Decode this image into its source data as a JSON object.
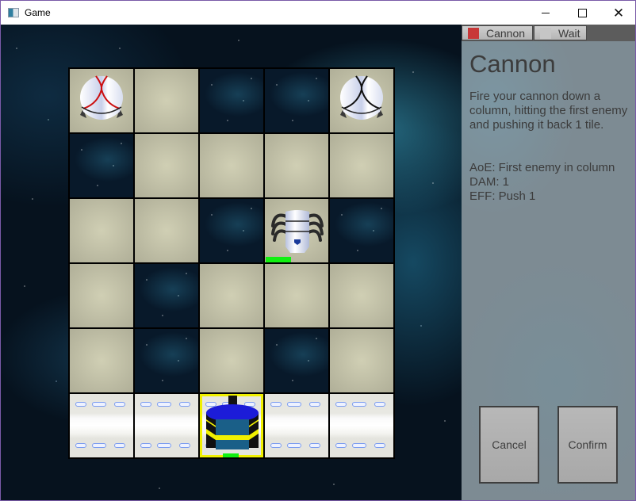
{
  "window": {
    "title": "Game",
    "controls": [
      "minimize",
      "maximize",
      "close"
    ]
  },
  "board": {
    "columns": 5,
    "rows": 6,
    "cells": [
      [
        "tan",
        "tan",
        "space",
        "space",
        "tan"
      ],
      [
        "space",
        "tan",
        "tan",
        "tan",
        "tan"
      ],
      [
        "tan",
        "tan",
        "space",
        "tan",
        "space"
      ],
      [
        "tan",
        "space",
        "tan",
        "tan",
        "tan"
      ],
      [
        "tan",
        "space",
        "tan",
        "space",
        "tan"
      ],
      [
        "base",
        "base",
        "base",
        "base",
        "base"
      ]
    ],
    "units": [
      {
        "type": "dome-enemy",
        "row": 0,
        "col": 0,
        "accent": "#cc1010"
      },
      {
        "type": "dome-enemy",
        "row": 0,
        "col": 4,
        "accent": "#111111"
      },
      {
        "type": "spider-enemy",
        "row": 2,
        "col": 3,
        "health_fraction": 1.0
      },
      {
        "type": "player-cannon",
        "row": 5,
        "col": 2,
        "selected": true,
        "health_fraction": 1.0
      }
    ],
    "colors": {
      "selection": "#f0f000",
      "health": "#10f010"
    }
  },
  "panel": {
    "tabs": [
      {
        "label": "Cannon",
        "swatch": "#c83838",
        "active": true
      },
      {
        "label": "Wait",
        "swatch": "#c6c6c6",
        "active": false
      }
    ],
    "ability": {
      "title": "Cannon",
      "description": "Fire your cannon down a column, hitting the first enemy and pushing it back 1 tile.",
      "aoe": "AoE: First enemy in column",
      "damage": "DAM: 1",
      "effect": "EFF: Push 1"
    },
    "buttons": {
      "cancel": "Cancel",
      "confirm": "Confirm"
    }
  }
}
